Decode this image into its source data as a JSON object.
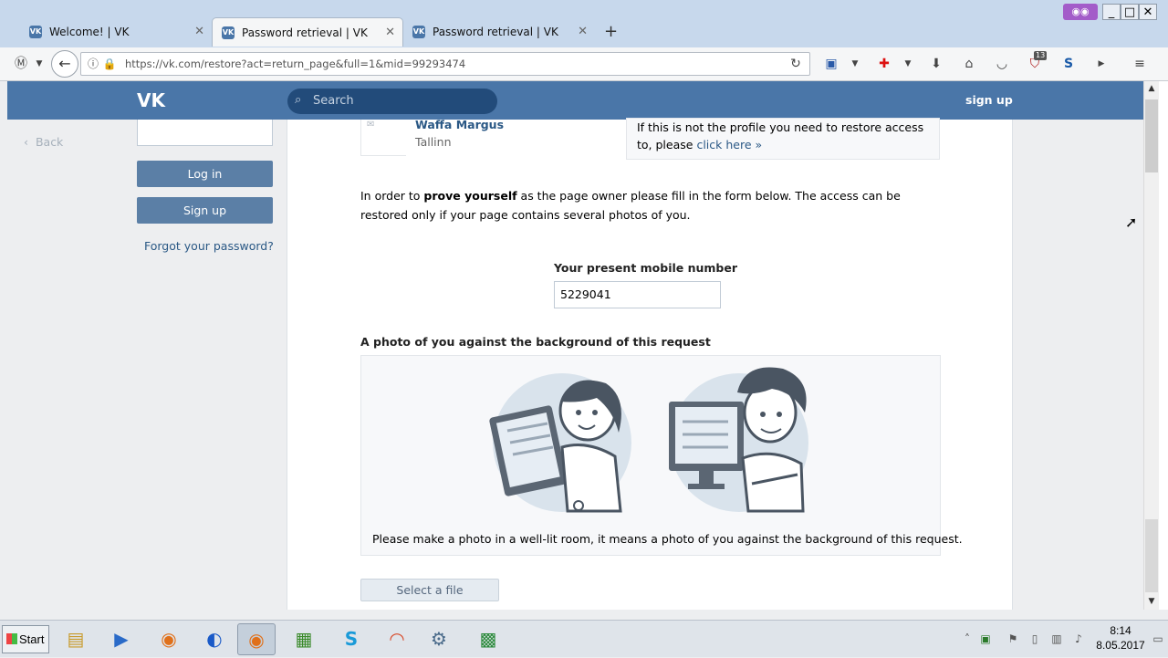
{
  "browser": {
    "tabs": [
      {
        "title": "Welcome! | VK",
        "active": false
      },
      {
        "title": "Password retrieval | VK",
        "active": true
      },
      {
        "title": "Password retrieval | VK",
        "active": false
      }
    ],
    "url": "https://vk.com/restore?act=return_page&full=1&mid=99293474",
    "toolbar_badge": "13"
  },
  "vk": {
    "header": {
      "logo": "VK",
      "search_placeholder": "Search",
      "signup": "sign up"
    },
    "left": {
      "back": "Back",
      "login_button": "Log in",
      "signup_button": "Sign up",
      "forgot": "Forgot your password?"
    },
    "profile": {
      "name": "Waffa Margus",
      "city": "Tallinn"
    },
    "note": {
      "text": "If this is not the profile you need to restore access to, please",
      "link": "click here »"
    },
    "intro": {
      "before": "In order to",
      "bold": "prove yourself",
      "after": "as the page owner please fill in the form below. The access can be restored only if your page contains several photos of you."
    },
    "form": {
      "phone_label": "Your present mobile number",
      "phone_value": "5229041",
      "photo_label": "A photo of you against the background of this request",
      "photo_hint": "Please make a photo in a well-lit room, it means a photo of you against the background of this request.",
      "file_button": "Select a file"
    }
  },
  "taskbar": {
    "start": "Start",
    "time": "8:14",
    "date": "8.05.2017"
  },
  "colors": {
    "vk_blue": "#4a76a8",
    "vk_link": "#2a5885",
    "button": "#5b7fa6"
  }
}
